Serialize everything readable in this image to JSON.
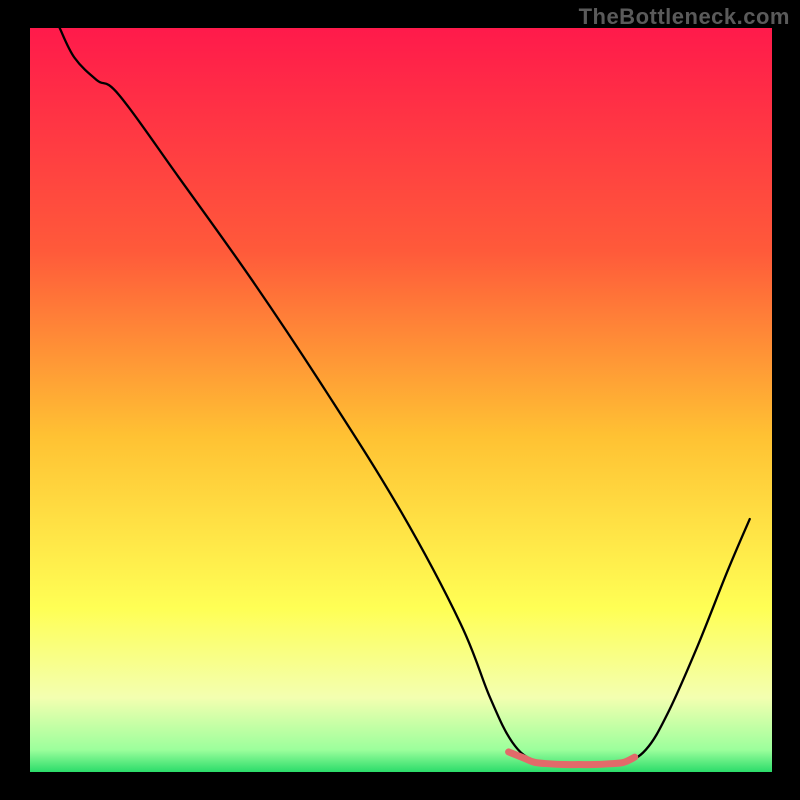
{
  "watermark": "TheBottleneck.com",
  "chart_data": {
    "type": "line",
    "title": "",
    "xlabel": "",
    "ylabel": "",
    "xlim": [
      0,
      100
    ],
    "ylim": [
      0,
      100
    ],
    "gradient_stops": [
      {
        "offset": 0,
        "color": "#ff1a4b"
      },
      {
        "offset": 30,
        "color": "#ff5a3a"
      },
      {
        "offset": 55,
        "color": "#ffc233"
      },
      {
        "offset": 78,
        "color": "#ffff55"
      },
      {
        "offset": 90,
        "color": "#f3ffb0"
      },
      {
        "offset": 97,
        "color": "#9cff9c"
      },
      {
        "offset": 100,
        "color": "#2bdc6a"
      }
    ],
    "series": [
      {
        "name": "bottleneck-curve",
        "color": "#000000",
        "width": 2.3,
        "points": [
          {
            "x": 4,
            "y": 100
          },
          {
            "x": 6,
            "y": 96
          },
          {
            "x": 9,
            "y": 93
          },
          {
            "x": 12,
            "y": 91
          },
          {
            "x": 20,
            "y": 80
          },
          {
            "x": 30,
            "y": 66
          },
          {
            "x": 40,
            "y": 51
          },
          {
            "x": 50,
            "y": 35
          },
          {
            "x": 58,
            "y": 20
          },
          {
            "x": 62,
            "y": 10
          },
          {
            "x": 65,
            "y": 4
          },
          {
            "x": 68,
            "y": 1.5
          },
          {
            "x": 72,
            "y": 1
          },
          {
            "x": 76,
            "y": 1
          },
          {
            "x": 80,
            "y": 1.3
          },
          {
            "x": 83,
            "y": 3
          },
          {
            "x": 86,
            "y": 8
          },
          {
            "x": 90,
            "y": 17
          },
          {
            "x": 94,
            "y": 27
          },
          {
            "x": 97,
            "y": 34
          }
        ]
      },
      {
        "name": "bottom-marker",
        "color": "#e26a6a",
        "width": 7,
        "points": [
          {
            "x": 64.5,
            "y": 2.7
          },
          {
            "x": 66.5,
            "y": 1.9
          },
          {
            "x": 68,
            "y": 1.3
          },
          {
            "x": 70,
            "y": 1.1
          },
          {
            "x": 72,
            "y": 1.0
          },
          {
            "x": 74,
            "y": 1.0
          },
          {
            "x": 76,
            "y": 1.0
          },
          {
            "x": 78,
            "y": 1.1
          },
          {
            "x": 80,
            "y": 1.3
          },
          {
            "x": 81.5,
            "y": 2.0
          }
        ]
      }
    ]
  }
}
